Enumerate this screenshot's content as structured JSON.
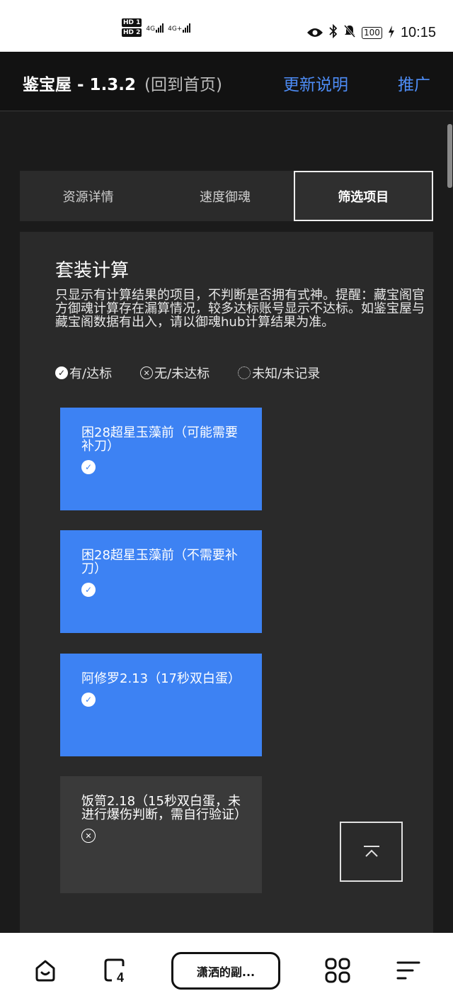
{
  "status_bar": {
    "sim1": "HD 1",
    "sim2": "HD 2",
    "net1": "4G",
    "net2": "4G+",
    "battery": "100",
    "time": "10:15"
  },
  "header": {
    "title": "鉴宝屋 - 1.3.2",
    "subtitle": "(回到首页)",
    "link_update": "更新说明",
    "link_promo": "推广"
  },
  "tabs": [
    {
      "label": "资源详情",
      "active": false
    },
    {
      "label": "速度御魂",
      "active": false
    },
    {
      "label": "筛选项目",
      "active": true
    }
  ],
  "section": {
    "title": "套装计算",
    "note": "只显示有计算结果的项目，不判断是否拥有式神。提醒：藏宝阁官方御魂计算存在漏算情况，较多达标账号显示不达标。如鉴宝屋与藏宝阁数据有出入，请以御魂hub计算结果为准。"
  },
  "legend": {
    "yes": "有/达标",
    "no": "无/未达标",
    "unknown": "未知/未记录"
  },
  "items": [
    {
      "label": "困28超星玉藻前（可能需要补刀）",
      "status": "yes"
    },
    {
      "label": "困28超星玉藻前（不需要补刀）",
      "status": "yes"
    },
    {
      "label": "阿修罗2.13（17秒双白蛋）",
      "status": "yes"
    },
    {
      "label": "饭笥2.18（15秒双白蛋，未进行爆伤判断，需自行验证）",
      "status": "no"
    }
  ],
  "bottom_nav": {
    "tab_count": "4",
    "current_tab": "潇洒的副..."
  },
  "colors": {
    "accent_blue": "#3d82f3",
    "link_blue": "#4d8cf5",
    "background": "#1b1b1b"
  }
}
